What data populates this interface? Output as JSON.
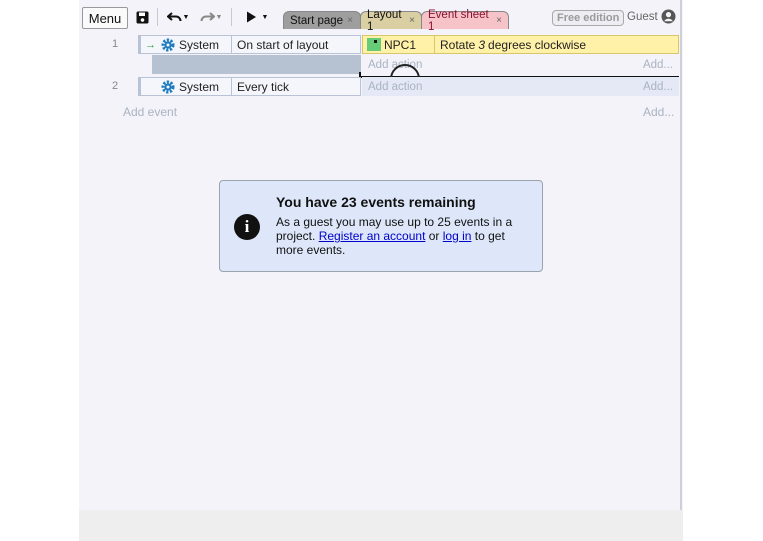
{
  "toolbar": {
    "menu_label": "Menu",
    "save_icon": "floppy-disk-icon",
    "undo_icon": "undo-icon",
    "redo_icon": "redo-icon",
    "play_icon": "play-icon",
    "caret_icon": "caret-down-icon"
  },
  "tabs": [
    {
      "label": "Start page",
      "close": "×"
    },
    {
      "label": "Layout 1",
      "close": "×"
    },
    {
      "label": "Event sheet 1",
      "close": "×"
    }
  ],
  "account": {
    "edition": "Free edition",
    "guest": "Guest",
    "user_icon": "user-circle-icon"
  },
  "events": [
    {
      "number": "1",
      "condition_object": "System",
      "condition_text": "On start of layout",
      "trigger_icon": "→",
      "action_object": "NPC1",
      "action_text_before": "Rotate ",
      "action_text_number": "3",
      "action_text_after": " degrees clockwise",
      "add_action": "Add action",
      "add_action_right": "Add..."
    },
    {
      "number": "2",
      "condition_object": "System",
      "condition_text": "Every tick",
      "add_action": "Add action",
      "add_action_right": "Add..."
    }
  ],
  "add_event": {
    "label": "Add event",
    "right": "Add..."
  },
  "info": {
    "icon": "info-icon",
    "glyph": "i",
    "title": "You have 23 events remaining",
    "text_1": "As a guest you may use up to 25 events in a project. ",
    "link_register": "Register an account",
    "text_2": " or ",
    "link_login": "log in",
    "text_3": " to get more events."
  },
  "colors": {
    "action_highlight": "#fff1a8",
    "npc_icon": "#66cc77",
    "gear": "#1e7bbf",
    "trigger_arrow": "#2a9a3a"
  }
}
